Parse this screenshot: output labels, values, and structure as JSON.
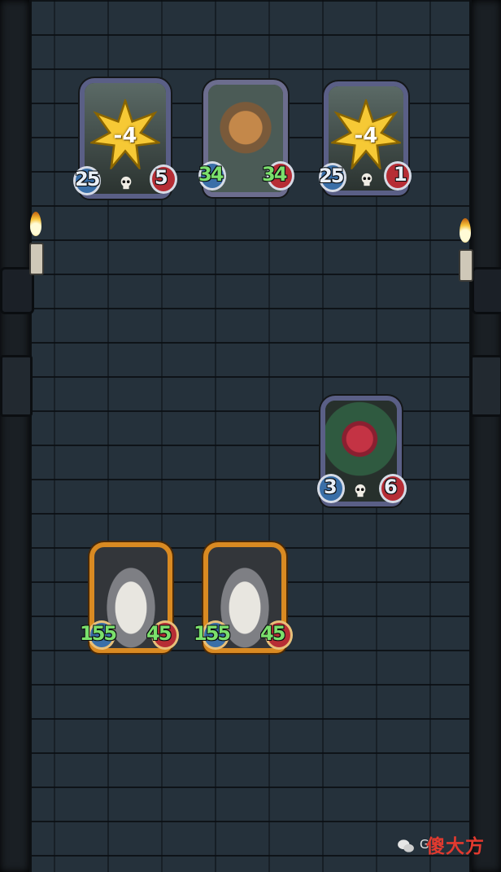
{
  "board": {
    "enemy_row": [
      {
        "name": "enemy-card-left",
        "effect_value": "-4",
        "attack": "25",
        "health": "5",
        "has_skull": true
      },
      {
        "name": "enemy-card-jester",
        "attack": "34",
        "health": "34",
        "attack_color": "green",
        "health_color": "green"
      },
      {
        "name": "enemy-card-right",
        "effect_value": "-4",
        "attack": "25",
        "health": "1",
        "has_skull": true
      }
    ],
    "middle": {
      "name": "plant-card",
      "attack": "3",
      "health": "6",
      "has_skull": true
    },
    "player_row": [
      {
        "name": "player-cat-card-1",
        "attack": "155",
        "health": "45"
      },
      {
        "name": "player-cat-card-2",
        "attack": "155",
        "health": "45"
      }
    ]
  },
  "watermark": {
    "icon": "wechat-icon",
    "prefix": "G",
    "brand": "傻大方"
  },
  "colors": {
    "stone": "#25313b",
    "gold_frame": "#d98a22",
    "attack_badge": "#3a6fa8",
    "health_badge": "#b62d35",
    "buff_text": "#7be06c",
    "burst": "#f6c935"
  }
}
